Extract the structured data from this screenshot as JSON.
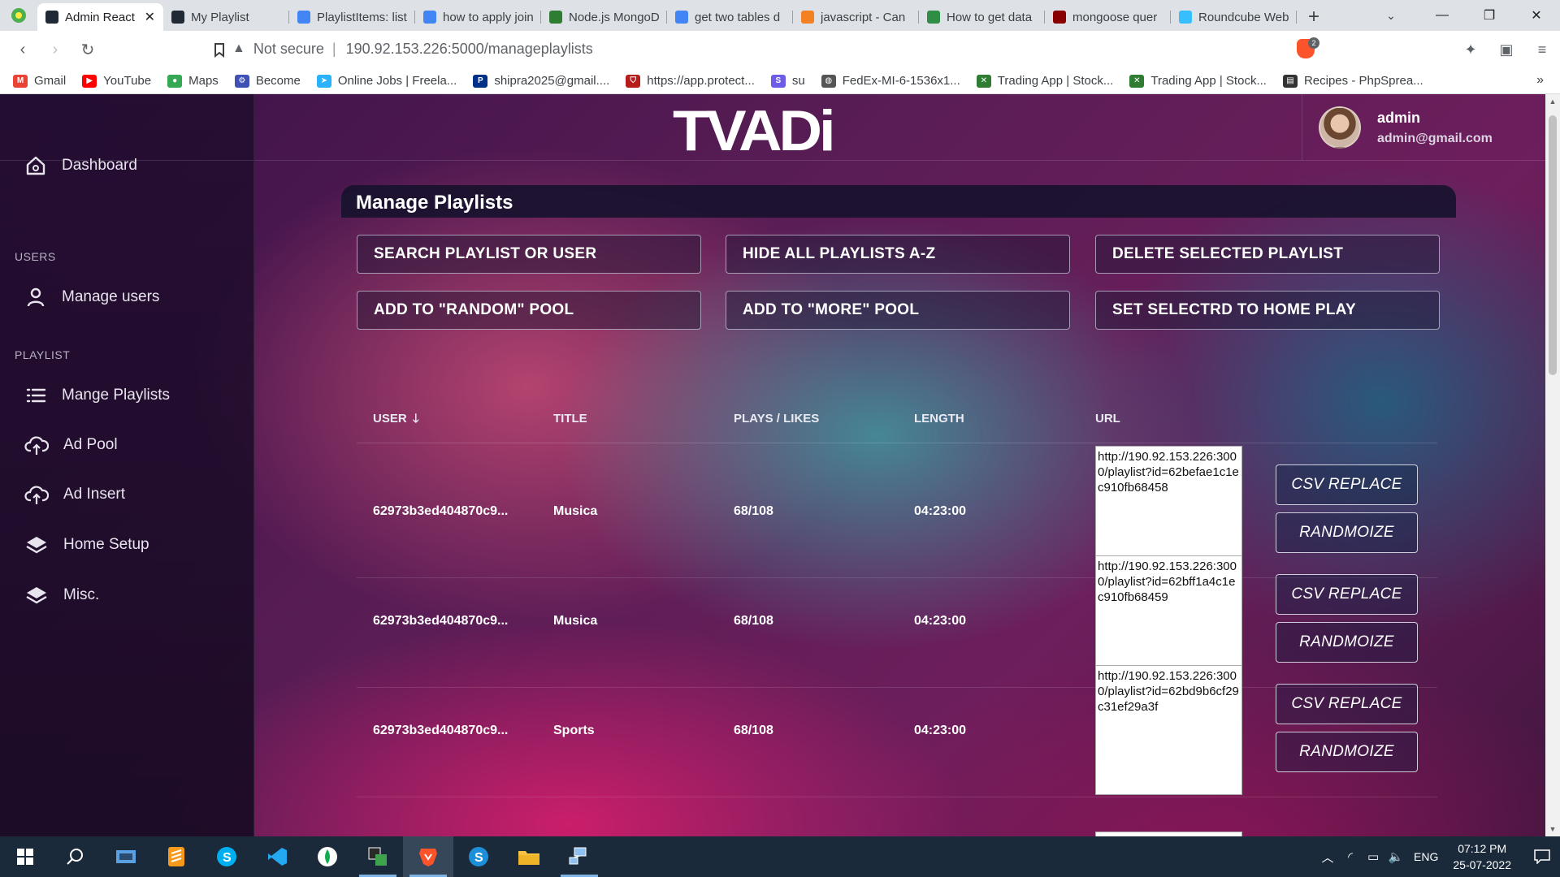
{
  "browser": {
    "tabs": [
      {
        "label": "Admin React",
        "active": true,
        "color": "#1f2a36"
      },
      {
        "label": "My Playlist",
        "active": false,
        "color": "#1f2a36"
      },
      {
        "label": "PlaylistItems: list",
        "active": false,
        "color": "#4285f4"
      },
      {
        "label": "how to apply join",
        "active": false,
        "color": "#4285f4"
      },
      {
        "label": "Node.js MongoDB",
        "active": false,
        "color": "#2e7d32"
      },
      {
        "label": "get two tables d",
        "active": false,
        "color": "#4285f4"
      },
      {
        "label": "javascript - Can",
        "active": false,
        "color": "#f48024"
      },
      {
        "label": "How to get data",
        "active": false,
        "color": "#2f8d46"
      },
      {
        "label": "mongoose quer",
        "active": false,
        "color": "#880000"
      },
      {
        "label": "Roundcube Web",
        "active": false,
        "color": "#37beff"
      }
    ],
    "tab_close": "✕",
    "new_tab": "+",
    "address": {
      "security": "Not secure",
      "separator": "|",
      "url": "190.92.153.226:5000/manageplaylists"
    },
    "shields_count": "2",
    "bookmarks": [
      {
        "label": "Gmail",
        "color": "#ea4335",
        "glyph": "M"
      },
      {
        "label": "YouTube",
        "color": "#ff0000",
        "glyph": "▶"
      },
      {
        "label": "Maps",
        "color": "#34a853",
        "glyph": "●"
      },
      {
        "label": "Become",
        "color": "#3f51b5",
        "glyph": "⚙"
      },
      {
        "label": "Online Jobs | Freela...",
        "color": "#29b2fe",
        "glyph": "➤"
      },
      {
        "label": "shipra2025@gmail....",
        "color": "#003087",
        "glyph": "P"
      },
      {
        "label": "https://app.protect...",
        "color": "#b71c1c",
        "glyph": "⛉"
      },
      {
        "label": "su",
        "color": "#6c5ce7",
        "glyph": "S"
      },
      {
        "label": "FedEx-MI-6-1536x1...",
        "color": "#555555",
        "glyph": "◍"
      },
      {
        "label": "Trading App | Stock...",
        "color": "#2e7d32",
        "glyph": "✕"
      },
      {
        "label": "Trading App | Stock...",
        "color": "#2e7d32",
        "glyph": "✕"
      },
      {
        "label": "Recipes - PhpSprea...",
        "color": "#333333",
        "glyph": "▤"
      }
    ],
    "bookmarks_more": "»"
  },
  "app": {
    "logo": "TVADi",
    "user": {
      "name": "admin",
      "email": "admin@gmail.com"
    },
    "sidebar": {
      "dashboard": "Dashboard",
      "section_users": "USERS",
      "manage_users": "Manage users",
      "section_playlist": "PLAYLIST",
      "manage_playlists": "Mange Playlists",
      "ad_pool": "Ad Pool",
      "ad_insert": "Ad Insert",
      "home_setup": "Home Setup",
      "misc": "Misc."
    },
    "panel_title": "Manage Playlists",
    "actions": {
      "search": "SEARCH PLAYLIST OR USER",
      "hide_all": "HIDE ALL PLAYLISTS A-Z",
      "delete_selected": "DELETE SELECTED PLAYLIST",
      "add_random": "ADD TO \"RANDOM\" POOL",
      "add_more": "ADD TO \"MORE\" POOL",
      "set_home": "SET SELECTRD TO HOME PLAY"
    },
    "table": {
      "headers": {
        "user": "USER",
        "title": "TITLE",
        "plays_likes": "PLAYS / LIKES",
        "length": "LENGTH",
        "url": "URL"
      },
      "rows": [
        {
          "user": "62973b3ed404870c9...",
          "title": "Musica",
          "plays_likes": "68/108",
          "length": "04:23:00",
          "url": "http://190.92.153.226:3000/playlist?id=62befae1c1ec910fb68458",
          "csv": "CSV REPLACE",
          "randomize": "RANDMOIZE"
        },
        {
          "user": "62973b3ed404870c9...",
          "title": "Musica",
          "plays_likes": "68/108",
          "length": "04:23:00",
          "url": "http://190.92.153.226:3000/playlist?id=62bff1a4c1ec910fb68459",
          "csv": "CSV REPLACE",
          "randomize": "RANDMOIZE"
        },
        {
          "user": "62973b3ed404870c9...",
          "title": "Sports",
          "plays_likes": "68/108",
          "length": "04:23:00",
          "url": "http://190.92.153.226:3000/playlist?id=62bd9b6cf29c31ef29a3f",
          "csv": "CSV REPLACE",
          "randomize": "RANDMOIZE"
        }
      ]
    }
  },
  "taskbar": {
    "language": "ENG",
    "time": "07:12 PM",
    "date": "25-07-2022"
  }
}
